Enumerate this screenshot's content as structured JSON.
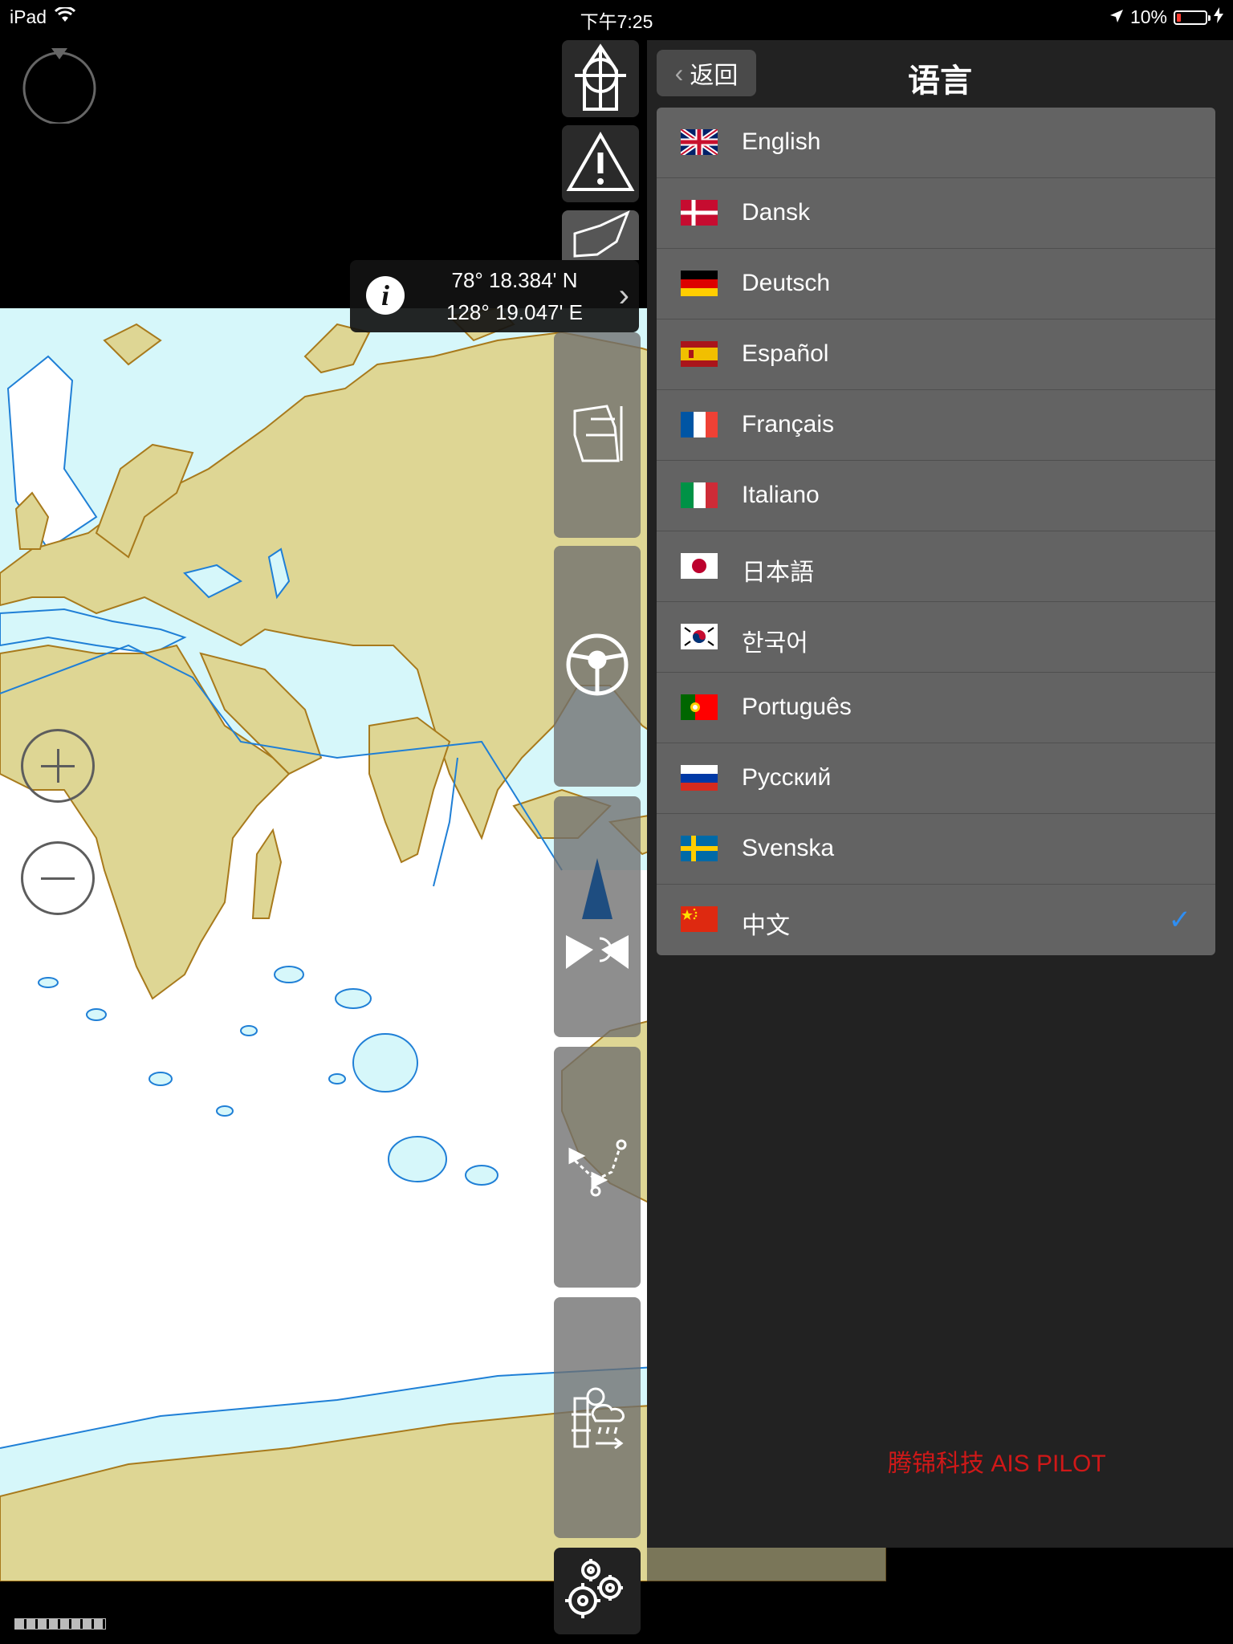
{
  "status_bar": {
    "device": "iPad",
    "time": "下午7:25",
    "battery_percent": "10%"
  },
  "coordinates": {
    "latitude": "78° 18.384' N",
    "longitude": "128° 19.047' E"
  },
  "toolbar": {
    "tools": [
      "target-icon",
      "warning-icon",
      "wind-sock-icon",
      "sail-trim-icon",
      "steering-wheel-icon",
      "ais-radar-icon",
      "route-icon",
      "weather-tide-icon",
      "settings-icon"
    ]
  },
  "panel": {
    "back_label": "返回",
    "title": "语言",
    "languages": [
      {
        "label": "English",
        "flag": "gb"
      },
      {
        "label": "Dansk",
        "flag": "dk"
      },
      {
        "label": "Deutsch",
        "flag": "de"
      },
      {
        "label": "Español",
        "flag": "es"
      },
      {
        "label": "Français",
        "flag": "fr"
      },
      {
        "label": "Italiano",
        "flag": "it"
      },
      {
        "label": "日本語",
        "flag": "jp"
      },
      {
        "label": "한국어",
        "flag": "kr"
      },
      {
        "label": "Português",
        "flag": "pt"
      },
      {
        "label": "Русский",
        "flag": "ru"
      },
      {
        "label": "Svenska",
        "flag": "se"
      },
      {
        "label": "中文",
        "flag": "cn",
        "selected": true
      }
    ]
  },
  "watermark": "腾锦科技 AIS PILOT",
  "colors": {
    "land": "#ded694",
    "shallow_water": "#d6f7fa",
    "deep_water": "#ffffff",
    "coastline": "#a87a1c",
    "depth_contour": "#1f7fd6",
    "selected_check": "#2f8ef2",
    "watermark": "#d01818"
  }
}
